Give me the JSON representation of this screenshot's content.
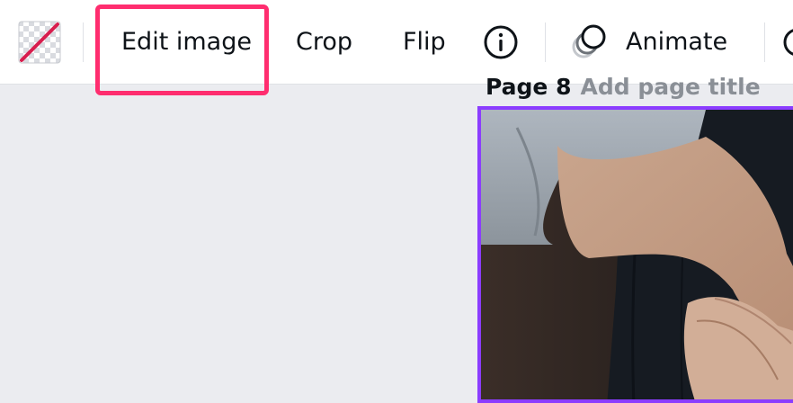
{
  "toolbar": {
    "transparency_icon": "transparency-icon",
    "edit_image_label": "Edit image",
    "crop_label": "Crop",
    "flip_label": "Flip",
    "info_icon": "info-icon",
    "animate_label": "Animate",
    "animate_icon": "animate-icon",
    "highlight_color": "#ff2d6f"
  },
  "canvas": {
    "page_label": "Page 8",
    "page_title_placeholder": "Add page title",
    "selection_color": "#8b3dff",
    "image_subject": "arm-photo"
  }
}
